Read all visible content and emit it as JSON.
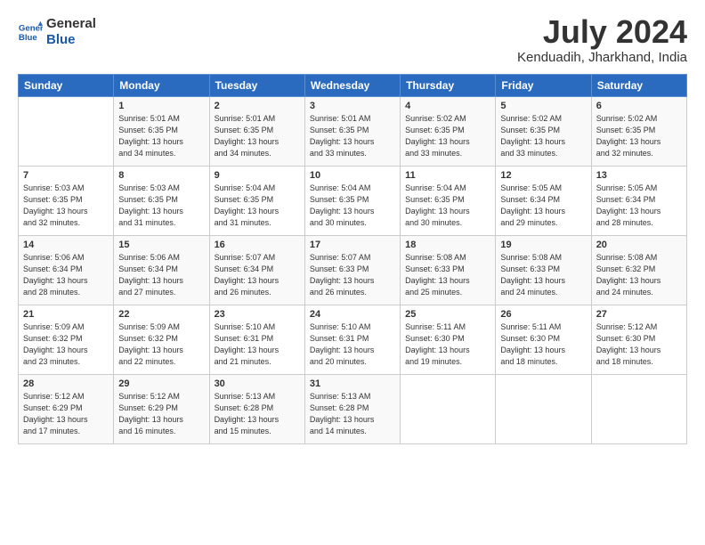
{
  "header": {
    "logo_line1": "General",
    "logo_line2": "Blue",
    "month": "July 2024",
    "location": "Kenduadih, Jharkhand, India"
  },
  "weekdays": [
    "Sunday",
    "Monday",
    "Tuesday",
    "Wednesday",
    "Thursday",
    "Friday",
    "Saturday"
  ],
  "weeks": [
    [
      {
        "day": null
      },
      {
        "day": 1,
        "rise": "5:01 AM",
        "set": "6:35 PM",
        "daylight": "13 hours and 34 minutes."
      },
      {
        "day": 2,
        "rise": "5:01 AM",
        "set": "6:35 PM",
        "daylight": "13 hours and 34 minutes."
      },
      {
        "day": 3,
        "rise": "5:01 AM",
        "set": "6:35 PM",
        "daylight": "13 hours and 33 minutes."
      },
      {
        "day": 4,
        "rise": "5:02 AM",
        "set": "6:35 PM",
        "daylight": "13 hours and 33 minutes."
      },
      {
        "day": 5,
        "rise": "5:02 AM",
        "set": "6:35 PM",
        "daylight": "13 hours and 33 minutes."
      },
      {
        "day": 6,
        "rise": "5:02 AM",
        "set": "6:35 PM",
        "daylight": "13 hours and 32 minutes."
      }
    ],
    [
      {
        "day": 7,
        "rise": "5:03 AM",
        "set": "6:35 PM",
        "daylight": "13 hours and 32 minutes."
      },
      {
        "day": 8,
        "rise": "5:03 AM",
        "set": "6:35 PM",
        "daylight": "13 hours and 31 minutes."
      },
      {
        "day": 9,
        "rise": "5:04 AM",
        "set": "6:35 PM",
        "daylight": "13 hours and 31 minutes."
      },
      {
        "day": 10,
        "rise": "5:04 AM",
        "set": "6:35 PM",
        "daylight": "13 hours and 30 minutes."
      },
      {
        "day": 11,
        "rise": "5:04 AM",
        "set": "6:35 PM",
        "daylight": "13 hours and 30 minutes."
      },
      {
        "day": 12,
        "rise": "5:05 AM",
        "set": "6:34 PM",
        "daylight": "13 hours and 29 minutes."
      },
      {
        "day": 13,
        "rise": "5:05 AM",
        "set": "6:34 PM",
        "daylight": "13 hours and 28 minutes."
      }
    ],
    [
      {
        "day": 14,
        "rise": "5:06 AM",
        "set": "6:34 PM",
        "daylight": "13 hours and 28 minutes."
      },
      {
        "day": 15,
        "rise": "5:06 AM",
        "set": "6:34 PM",
        "daylight": "13 hours and 27 minutes."
      },
      {
        "day": 16,
        "rise": "5:07 AM",
        "set": "6:34 PM",
        "daylight": "13 hours and 26 minutes."
      },
      {
        "day": 17,
        "rise": "5:07 AM",
        "set": "6:33 PM",
        "daylight": "13 hours and 26 minutes."
      },
      {
        "day": 18,
        "rise": "5:08 AM",
        "set": "6:33 PM",
        "daylight": "13 hours and 25 minutes."
      },
      {
        "day": 19,
        "rise": "5:08 AM",
        "set": "6:33 PM",
        "daylight": "13 hours and 24 minutes."
      },
      {
        "day": 20,
        "rise": "5:08 AM",
        "set": "6:32 PM",
        "daylight": "13 hours and 24 minutes."
      }
    ],
    [
      {
        "day": 21,
        "rise": "5:09 AM",
        "set": "6:32 PM",
        "daylight": "13 hours and 23 minutes."
      },
      {
        "day": 22,
        "rise": "5:09 AM",
        "set": "6:32 PM",
        "daylight": "13 hours and 22 minutes."
      },
      {
        "day": 23,
        "rise": "5:10 AM",
        "set": "6:31 PM",
        "daylight": "13 hours and 21 minutes."
      },
      {
        "day": 24,
        "rise": "5:10 AM",
        "set": "6:31 PM",
        "daylight": "13 hours and 20 minutes."
      },
      {
        "day": 25,
        "rise": "5:11 AM",
        "set": "6:30 PM",
        "daylight": "13 hours and 19 minutes."
      },
      {
        "day": 26,
        "rise": "5:11 AM",
        "set": "6:30 PM",
        "daylight": "13 hours and 18 minutes."
      },
      {
        "day": 27,
        "rise": "5:12 AM",
        "set": "6:30 PM",
        "daylight": "13 hours and 18 minutes."
      }
    ],
    [
      {
        "day": 28,
        "rise": "5:12 AM",
        "set": "6:29 PM",
        "daylight": "13 hours and 17 minutes."
      },
      {
        "day": 29,
        "rise": "5:12 AM",
        "set": "6:29 PM",
        "daylight": "13 hours and 16 minutes."
      },
      {
        "day": 30,
        "rise": "5:13 AM",
        "set": "6:28 PM",
        "daylight": "13 hours and 15 minutes."
      },
      {
        "day": 31,
        "rise": "5:13 AM",
        "set": "6:28 PM",
        "daylight": "13 hours and 14 minutes."
      },
      {
        "day": null
      },
      {
        "day": null
      },
      {
        "day": null
      }
    ]
  ]
}
